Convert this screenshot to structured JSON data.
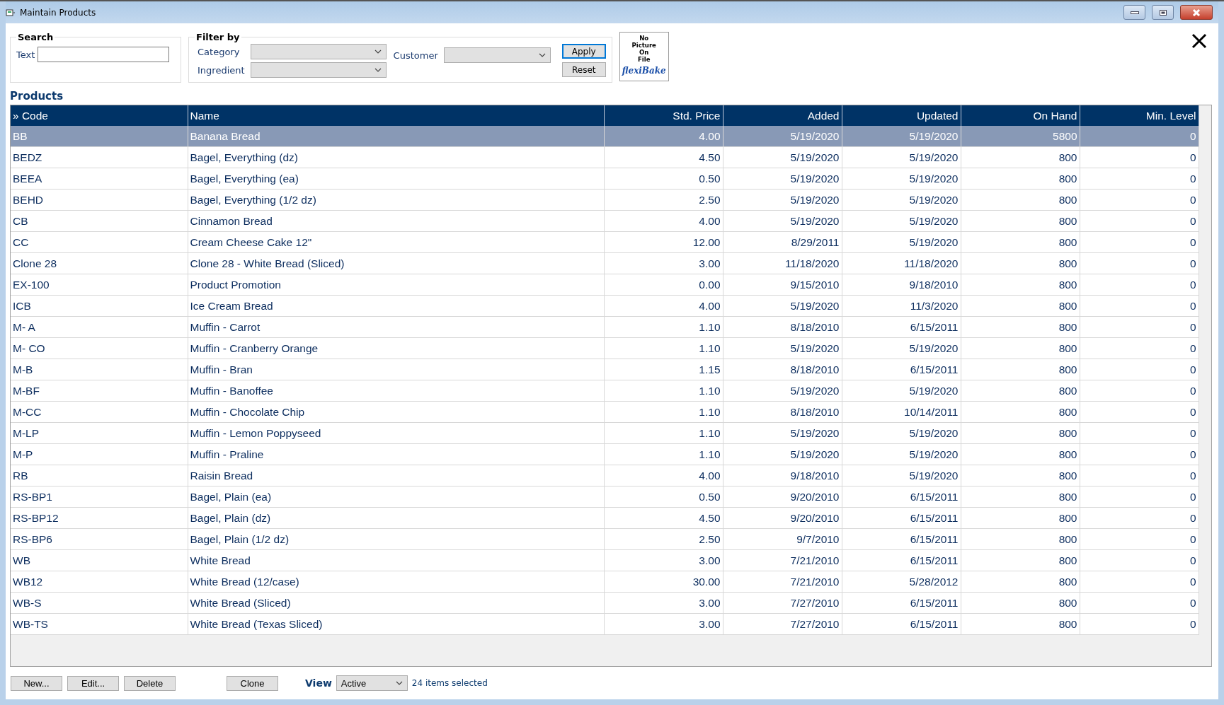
{
  "window": {
    "title": "Maintain Products"
  },
  "search": {
    "legend": "Search",
    "text_label": "Text"
  },
  "filter": {
    "legend": "Filter by",
    "category_label": "Category",
    "ingredient_label": "Ingredient",
    "customer_label": "Customer",
    "apply": "Apply",
    "reset": "Reset"
  },
  "picture": {
    "caption_lines": [
      "No",
      "Picture",
      "On",
      "File"
    ],
    "logo": "flexiBake"
  },
  "products": {
    "title": "Products",
    "columns": [
      "» Code",
      "Name",
      "Std. Price",
      "Added",
      "Updated",
      "On Hand",
      "Min. Level"
    ],
    "rows": [
      {
        "selected": true,
        "cells": [
          "BB",
          "Banana Bread",
          "4.00",
          "5/19/2020",
          "5/19/2020",
          "5800",
          "0"
        ]
      },
      {
        "selected": false,
        "cells": [
          "BEDZ",
          "Bagel, Everything (dz)",
          "4.50",
          "5/19/2020",
          "5/19/2020",
          "800",
          "0"
        ]
      },
      {
        "selected": false,
        "cells": [
          "BEEA",
          "Bagel, Everything (ea)",
          "0.50",
          "5/19/2020",
          "5/19/2020",
          "800",
          "0"
        ]
      },
      {
        "selected": false,
        "cells": [
          "BEHD",
          "Bagel, Everything (1/2 dz)",
          "2.50",
          "5/19/2020",
          "5/19/2020",
          "800",
          "0"
        ]
      },
      {
        "selected": false,
        "cells": [
          "CB",
          "Cinnamon Bread",
          "4.00",
          "5/19/2020",
          "5/19/2020",
          "800",
          "0"
        ]
      },
      {
        "selected": false,
        "cells": [
          "CC",
          "Cream Cheese Cake 12\"",
          "12.00",
          "8/29/2011",
          "5/19/2020",
          "800",
          "0"
        ]
      },
      {
        "selected": false,
        "cells": [
          "Clone 28",
          "Clone 28 - White Bread (Sliced)",
          "3.00",
          "11/18/2020",
          "11/18/2020",
          "800",
          "0"
        ]
      },
      {
        "selected": false,
        "cells": [
          "EX-100",
          "Product Promotion",
          "0.00",
          "9/15/2010",
          "9/18/2010",
          "800",
          "0"
        ]
      },
      {
        "selected": false,
        "cells": [
          "ICB",
          "Ice Cream Bread",
          "4.00",
          "5/19/2020",
          "11/3/2020",
          "800",
          "0"
        ]
      },
      {
        "selected": false,
        "cells": [
          "M- A",
          "Muffin - Carrot",
          "1.10",
          "8/18/2010",
          "6/15/2011",
          "800",
          "0"
        ]
      },
      {
        "selected": false,
        "cells": [
          "M- CO",
          "Muffin - Cranberry Orange",
          "1.10",
          "5/19/2020",
          "5/19/2020",
          "800",
          "0"
        ]
      },
      {
        "selected": false,
        "cells": [
          "M-B",
          "Muffin - Bran",
          "1.15",
          "8/18/2010",
          "6/15/2011",
          "800",
          "0"
        ]
      },
      {
        "selected": false,
        "cells": [
          "M-BF",
          "Muffin - Banoffee",
          "1.10",
          "5/19/2020",
          "5/19/2020",
          "800",
          "0"
        ]
      },
      {
        "selected": false,
        "cells": [
          "M-CC",
          "Muffin - Chocolate Chip",
          "1.10",
          "8/18/2010",
          "10/14/2011",
          "800",
          "0"
        ]
      },
      {
        "selected": false,
        "cells": [
          "M-LP",
          "Muffin - Lemon Poppyseed",
          "1.10",
          "5/19/2020",
          "5/19/2020",
          "800",
          "0"
        ]
      },
      {
        "selected": false,
        "cells": [
          "M-P",
          "Muffin - Praline",
          "1.10",
          "5/19/2020",
          "5/19/2020",
          "800",
          "0"
        ]
      },
      {
        "selected": false,
        "cells": [
          "RB",
          "Raisin Bread",
          "4.00",
          "9/18/2010",
          "5/19/2020",
          "800",
          "0"
        ]
      },
      {
        "selected": false,
        "cells": [
          "RS-BP1",
          "Bagel, Plain (ea)",
          "0.50",
          "9/20/2010",
          "6/15/2011",
          "800",
          "0"
        ]
      },
      {
        "selected": false,
        "cells": [
          "RS-BP12",
          "Bagel, Plain (dz)",
          "4.50",
          "9/20/2010",
          "6/15/2011",
          "800",
          "0"
        ]
      },
      {
        "selected": false,
        "cells": [
          "RS-BP6",
          "Bagel, Plain (1/2 dz)",
          "2.50",
          "9/7/2010",
          "6/15/2011",
          "800",
          "0"
        ]
      },
      {
        "selected": false,
        "cells": [
          "WB",
          "White Bread",
          "3.00",
          "7/21/2010",
          "6/15/2011",
          "800",
          "0"
        ]
      },
      {
        "selected": false,
        "cells": [
          "WB12",
          "White Bread (12/case)",
          "30.00",
          "7/21/2010",
          "5/28/2012",
          "800",
          "0"
        ]
      },
      {
        "selected": false,
        "cells": [
          "WB-S",
          "White Bread (Sliced)",
          "3.00",
          "7/27/2010",
          "6/15/2011",
          "800",
          "0"
        ]
      },
      {
        "selected": false,
        "cells": [
          "WB-TS",
          "White Bread (Texas Sliced)",
          "3.00",
          "7/27/2010",
          "6/15/2011",
          "800",
          "0"
        ]
      }
    ]
  },
  "footer": {
    "buttons": [
      "New...",
      "Edit...",
      "Delete",
      "Clone"
    ],
    "view_label": "View",
    "view_value": "Active",
    "status": "24 items selected"
  }
}
